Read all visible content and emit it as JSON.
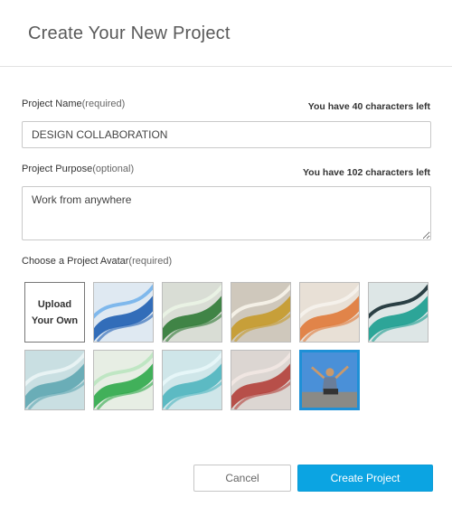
{
  "dialog": {
    "title": "Create Your New Project"
  },
  "name_field": {
    "label": "Project Name",
    "qualifier": "(required)",
    "counter": "You have 40 characters left",
    "value": "DESIGN COLLABORATION"
  },
  "purpose_field": {
    "label": "Project Purpose",
    "qualifier": "(optional)",
    "counter": "You have 102 characters left",
    "value": "Work from anywhere"
  },
  "avatar_section": {
    "label": "Choose a Project Avatar",
    "qualifier": "(required)",
    "upload_line1": "Upload",
    "upload_line2": "Your Own",
    "avatars": [
      {
        "name": "avatar-blue-ribbon",
        "colors": [
          "#dfe9f2",
          "#1f5fb3",
          "#7fb8ec"
        ]
      },
      {
        "name": "avatar-green-stripes",
        "colors": [
          "#d9ddd5",
          "#2f7a36",
          "#e9f2e4"
        ]
      },
      {
        "name": "avatar-gold-knot",
        "colors": [
          "#cfc8bc",
          "#c59a2a",
          "#f4f0e6"
        ]
      },
      {
        "name": "avatar-orange-glass",
        "colors": [
          "#e8e0d6",
          "#e07a3a",
          "#f5f1eb"
        ]
      },
      {
        "name": "avatar-teal-twist",
        "colors": [
          "#dde6e6",
          "#1a9d8f",
          "#2a3f44"
        ]
      },
      {
        "name": "avatar-aqua-wave",
        "colors": [
          "#c9dfe2",
          "#5fa7b2",
          "#e8f3f4"
        ]
      },
      {
        "name": "avatar-green-sphere",
        "colors": [
          "#e7eee4",
          "#2fa84a",
          "#bfe6c3"
        ]
      },
      {
        "name": "avatar-cyan-bubbles",
        "colors": [
          "#cfe6e9",
          "#4fb5bf",
          "#e6f6f8"
        ]
      },
      {
        "name": "avatar-red-ribbon",
        "colors": [
          "#dcd6d2",
          "#b3403a",
          "#f0e6e2"
        ]
      },
      {
        "name": "avatar-person-laptop",
        "colors": [
          "#4a90d8",
          "#d7b48a",
          "#8a8a86"
        ],
        "selected": true
      }
    ]
  },
  "actions": {
    "cancel": "Cancel",
    "create": "Create Project"
  }
}
